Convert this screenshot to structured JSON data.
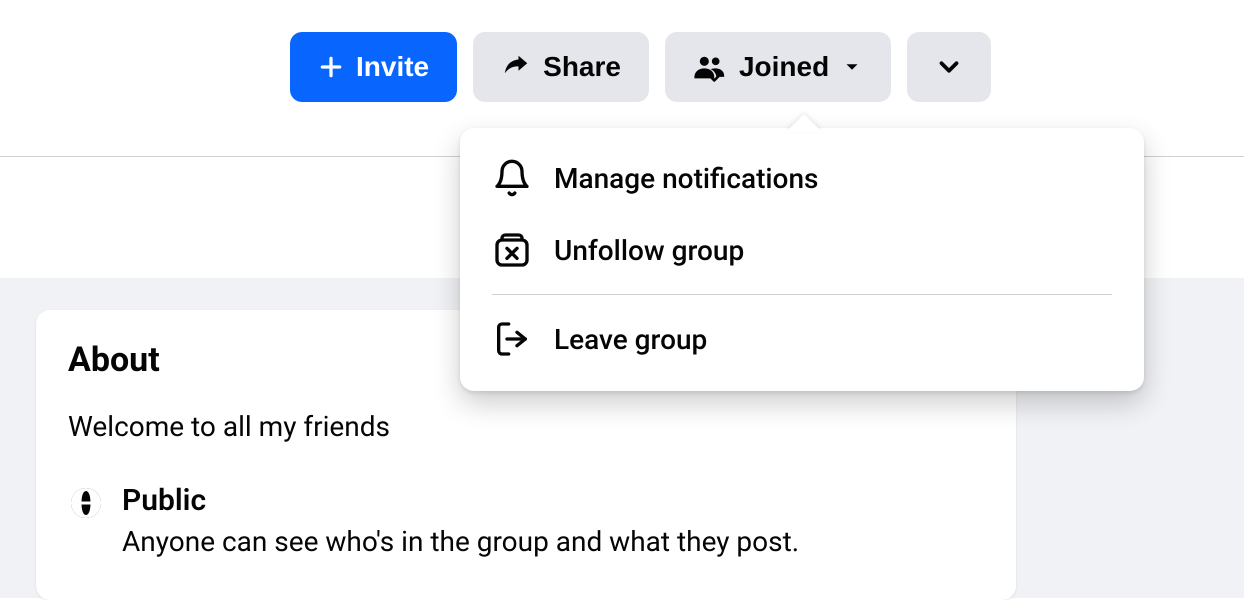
{
  "toolbar": {
    "invite_label": "Invite",
    "share_label": "Share",
    "joined_label": "Joined"
  },
  "dropdown": {
    "items": [
      {
        "label": "Manage notifications"
      },
      {
        "label": "Unfollow group"
      },
      {
        "label": "Leave group"
      }
    ]
  },
  "about": {
    "heading": "About",
    "description": "Welcome to all my friends",
    "privacy": {
      "title": "Public",
      "subtitle": "Anyone can see who's in the group and what they post."
    }
  }
}
